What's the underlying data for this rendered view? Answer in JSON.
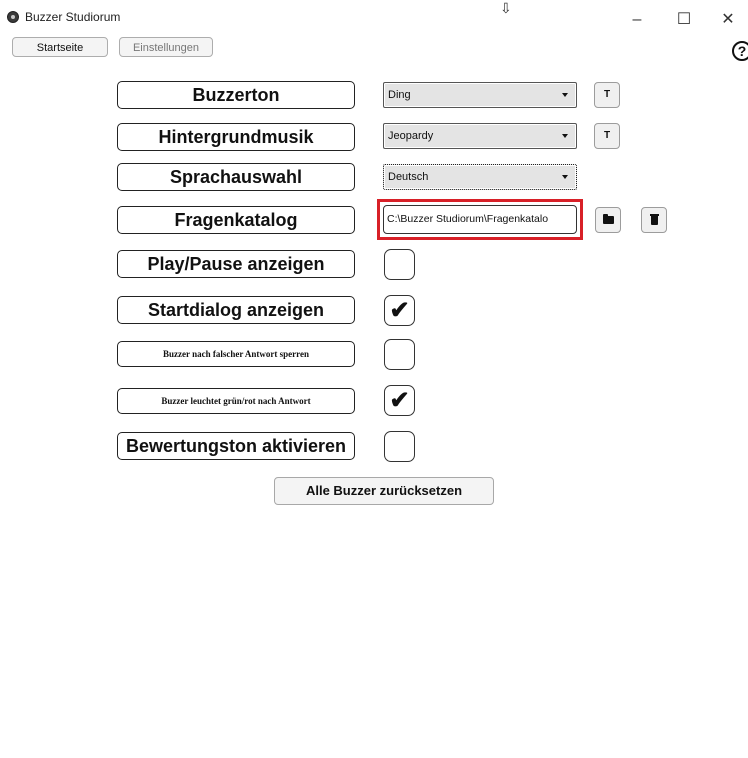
{
  "window": {
    "title": "Buzzer Studiorum",
    "cursor_glyph": "⇩",
    "controls": {
      "minimize": "–",
      "maximize": "☐",
      "close": "✕"
    }
  },
  "toolbar": {
    "home_label": "Startseite",
    "settings_label": "Einstellungen",
    "help_icon": "help-icon"
  },
  "settings": {
    "buzzer_tone": {
      "label": "Buzzerton",
      "value": "Ding",
      "test_label": "T"
    },
    "background_music": {
      "label": "Hintergrundmusik",
      "value": "Jeopardy",
      "test_label": "T"
    },
    "language": {
      "label": "Sprachauswahl",
      "value": "Deutsch"
    },
    "question_catalog": {
      "label": "Fragenkatalog",
      "path": "C:\\Buzzer Studiorum\\Fragenkatalo",
      "browse_icon": "folder-icon",
      "delete_icon": "trash-icon"
    },
    "show_play_pause": {
      "label": "Play/Pause anzeigen",
      "checked": false
    },
    "show_start_dialog": {
      "label": "Startdialog anzeigen",
      "checked": true
    },
    "lock_after_wrong": {
      "label": "Buzzer nach falscher Antwort sperren",
      "checked": false
    },
    "light_after_answer": {
      "label": "Buzzer leuchtet grün/rot nach Antwort",
      "checked": true
    },
    "rating_tone": {
      "label": "Bewertungston aktivieren",
      "checked": false
    },
    "check_glyph": "✔"
  },
  "reset_button_label": "Alle Buzzer zurücksetzen",
  "colors": {
    "highlight": "#d82028"
  }
}
